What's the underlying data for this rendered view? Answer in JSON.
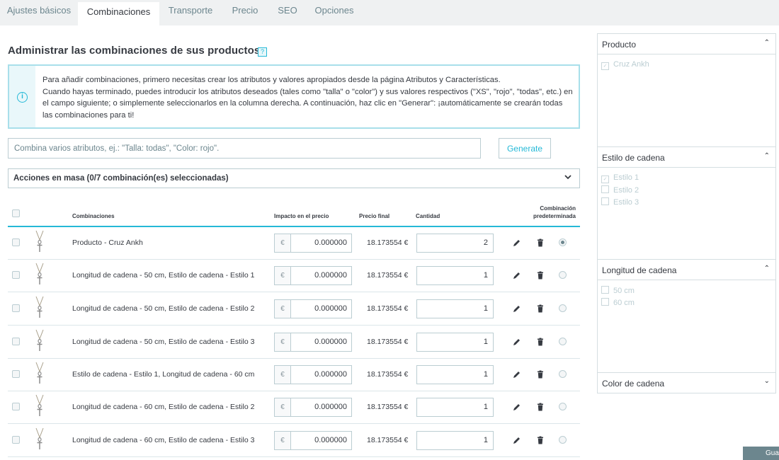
{
  "tabs": [
    {
      "label": "Ajustes básicos",
      "active": false
    },
    {
      "label": "Combinaciones",
      "active": true
    },
    {
      "label": "Transporte",
      "active": false
    },
    {
      "label": "Precio",
      "active": false
    },
    {
      "label": "SEO",
      "active": false
    },
    {
      "label": "Opciones",
      "active": false
    }
  ],
  "page": {
    "title": "Administrar las combinaciones de sus productos",
    "help_icon": "?"
  },
  "info": {
    "icon": "info-icon",
    "line1": "Para añadir combinaciones, primero necesitas crear los atributos y valores apropiados desde la página Atributos y Características.",
    "line2": "Cuando hayas terminado, puedes introducir los atributos deseados (tales como \"talla\" o \"color\") y sus valores respectivos (\"XS\", \"rojo\", \"todas\", etc.) en el campo siguiente; o simplemente seleccionarlos en la columna derecha. A continuación, haz clic en \"Generar\": ¡automáticamente se crearán todas las combinaciones para ti!"
  },
  "generator": {
    "placeholder": "Combina varios atributos, ej.: \"Talla: todas\", \"Color: rojo\".",
    "value": "",
    "button": "Generate"
  },
  "bulk": {
    "label": "Acciones en masa (0/7 combinación(es) seleccionadas)"
  },
  "table": {
    "headers": {
      "combinations": "Combinaciones",
      "impact": "Impacto en el precio",
      "final": "Precio final",
      "quantity": "Cantidad",
      "default_line1": "Combinación",
      "default_line2": "predeterminada"
    },
    "currency": "€",
    "rows": [
      {
        "name": "Producto - Cruz Ankh",
        "impact": "0.000000",
        "final": "18.173554 €",
        "qty": "2",
        "default": true
      },
      {
        "name": "Longitud de cadena - 50 cm, Estilo de cadena - Estilo 1",
        "impact": "0.000000",
        "final": "18.173554 €",
        "qty": "1",
        "default": false
      },
      {
        "name": "Longitud de cadena - 50 cm, Estilo de cadena - Estilo 2",
        "impact": "0.000000",
        "final": "18.173554 €",
        "qty": "1",
        "default": false
      },
      {
        "name": "Longitud de cadena - 50 cm, Estilo de cadena - Estilo 3",
        "impact": "0.000000",
        "final": "18.173554 €",
        "qty": "1",
        "default": false
      },
      {
        "name": "Estilo de cadena - Estilo 1, Longitud de cadena - 60 cm",
        "impact": "0.000000",
        "final": "18.173554 €",
        "qty": "1",
        "default": false
      },
      {
        "name": "Longitud de cadena - 60 cm, Estilo de cadena - Estilo 2",
        "impact": "0.000000",
        "final": "18.173554 €",
        "qty": "1",
        "default": false
      },
      {
        "name": "Longitud de cadena - 60 cm, Estilo de cadena - Estilo 3",
        "impact": "0.000000",
        "final": "18.173554 €",
        "qty": "1",
        "default": false
      }
    ]
  },
  "filters": [
    {
      "title": "Producto",
      "expanded": true,
      "items": [
        {
          "label": "Cruz Ankh",
          "checked": true
        }
      ]
    },
    {
      "title": "Estilo de cadena",
      "expanded": true,
      "items": [
        {
          "label": "Estilo 1",
          "checked": true
        },
        {
          "label": "Estilo 2",
          "checked": false
        },
        {
          "label": "Estilo 3",
          "checked": false
        }
      ]
    },
    {
      "title": "Longitud de cadena",
      "expanded": true,
      "items": [
        {
          "label": "50 cm",
          "checked": false
        },
        {
          "label": "60 cm",
          "checked": false
        }
      ]
    },
    {
      "title": "Color de cadena",
      "expanded": false,
      "items": []
    }
  ],
  "save_button": "Gua",
  "colors": {
    "accent": "#25b9d7",
    "tabbar_bg": "#eff1f2",
    "text": "#363a41",
    "border": "#bbcdd2",
    "info_border": "#a8dfea",
    "save_bg": "#6c868e"
  }
}
